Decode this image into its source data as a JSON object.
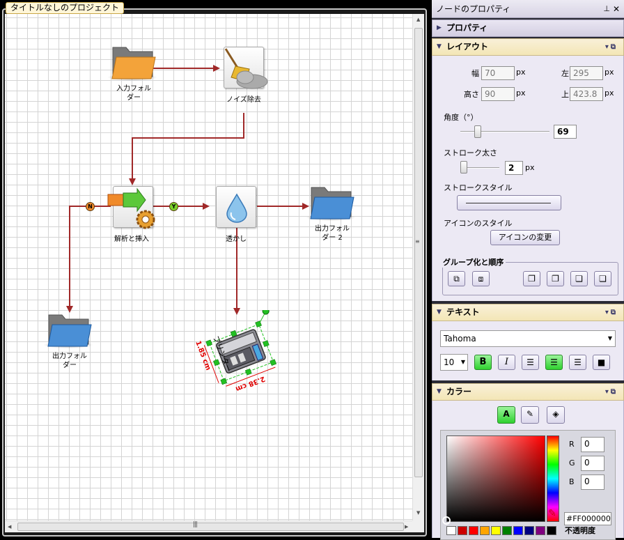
{
  "document": {
    "tab_title": "タイトルなしのプロジェクト"
  },
  "nodes": {
    "input_folder": "入力フォル\nダー",
    "noise_removal": "ノイズ除去",
    "parse_insert": "解析と挿入",
    "watermark": "透かし",
    "output_folder_2": "出力フォル\nダー 2",
    "output_folder": "出力フォル\nダー",
    "printer": "プリンター"
  },
  "badges": {
    "no": "N",
    "yes": "Y"
  },
  "dimensions": {
    "height": "1.85 cm",
    "width": "2.38 cm"
  },
  "panel": {
    "title": "ノードのプロパティ",
    "pin_icon": "pin-icon",
    "close_icon": "close-icon",
    "properties_section": "プロパティ",
    "layout_section": "レイアウト",
    "width_label": "幅",
    "width_value": "70",
    "height_label": "高さ",
    "height_value": "90",
    "left_label": "左",
    "left_value": "295",
    "top_label": "上",
    "top_value": "423.8",
    "unit_px": "px",
    "angle_label": "角度（°）",
    "angle_value": "69",
    "stroke_width_label": "ストローク太さ",
    "stroke_width_value": "2",
    "stroke_style_label": "ストロークスタイル",
    "icon_style_label": "アイコンのスタイル",
    "change_icon_button": "アイコンの変更",
    "group_order_label": "グループ化と順序",
    "text_section": "テキスト",
    "font_name": "Tahoma",
    "font_size": "10",
    "bold_label": "B",
    "italic_label": "I",
    "color_section": "カラー",
    "r_label": "R",
    "r_value": "0",
    "g_label": "G",
    "g_value": "0",
    "b_label": "B",
    "b_value": "0",
    "hex_value": "#FF000000",
    "opacity_label": "不透明度"
  },
  "colors": {
    "connector": "#a02828",
    "accent": "#f3e6b6",
    "selection": "#22c022",
    "dimension": "#e00000"
  },
  "palette": [
    "#ffffff",
    "#cc0000",
    "#ff0000",
    "#ffa500",
    "#ffff00",
    "#008000",
    "#0000ff",
    "#000080",
    "#800080",
    "#000000"
  ]
}
